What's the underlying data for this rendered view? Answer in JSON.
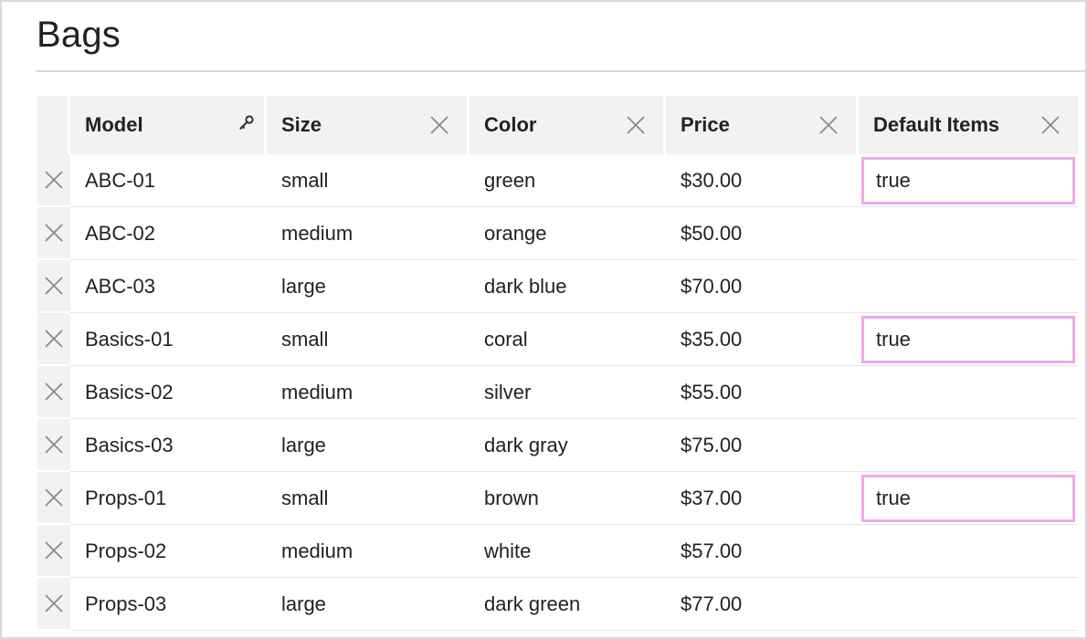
{
  "page": {
    "title": "Bags"
  },
  "colors": {
    "highlight": "#f0a8ec",
    "header_bg": "#f2f2f2",
    "rule": "#d9d9d9"
  },
  "columns": [
    {
      "label": "Model",
      "icon": "key-icon"
    },
    {
      "label": "Size",
      "icon": "close-icon"
    },
    {
      "label": "Color",
      "icon": "close-icon"
    },
    {
      "label": "Price",
      "icon": "close-icon"
    },
    {
      "label": "Default Items",
      "icon": "close-icon"
    }
  ],
  "rows": [
    {
      "model": "ABC-01",
      "size": "small",
      "color": "green",
      "price": "$30.00",
      "default": "true"
    },
    {
      "model": "ABC-02",
      "size": "medium",
      "color": "orange",
      "price": "$50.00",
      "default": ""
    },
    {
      "model": "ABC-03",
      "size": "large",
      "color": "dark blue",
      "price": "$70.00",
      "default": ""
    },
    {
      "model": "Basics-01",
      "size": "small",
      "color": "coral",
      "price": "$35.00",
      "default": "true"
    },
    {
      "model": "Basics-02",
      "size": "medium",
      "color": "silver",
      "price": "$55.00",
      "default": ""
    },
    {
      "model": "Basics-03",
      "size": "large",
      "color": "dark gray",
      "price": "$75.00",
      "default": ""
    },
    {
      "model": "Props-01",
      "size": "small",
      "color": "brown",
      "price": "$37.00",
      "default": "true"
    },
    {
      "model": "Props-02",
      "size": "medium",
      "color": "white",
      "price": "$57.00",
      "default": ""
    },
    {
      "model": "Props-03",
      "size": "large",
      "color": "dark green",
      "price": "$77.00",
      "default": ""
    }
  ]
}
